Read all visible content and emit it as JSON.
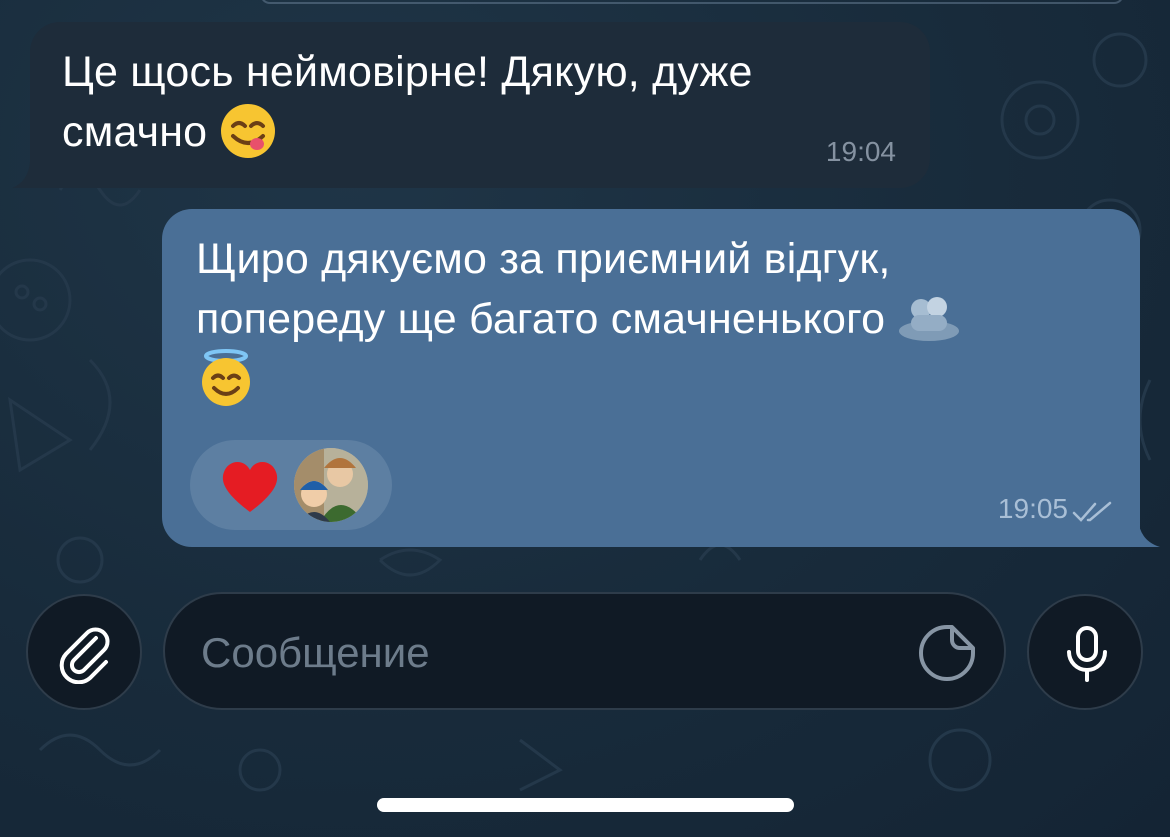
{
  "messages": [
    {
      "direction": "incoming",
      "line1": "Це щось неймовірне! Дякую, дуже",
      "line2": "смачно",
      "emoji": "yum-face",
      "time": "19:04"
    },
    {
      "direction": "outgoing",
      "line1": "Щиро дякуємо за приємний відгук,",
      "line2": "попереду ще багато смачненького",
      "emojis": [
        "hug-sticker",
        "halo-smile-face"
      ],
      "time": "19:05",
      "read": true,
      "reaction": {
        "emoji": "red-heart",
        "reactor": "avatar-photo"
      }
    }
  ],
  "composer": {
    "placeholder": "Сообщение",
    "attach_icon": "paperclip-icon",
    "sticker_icon": "sticker-icon",
    "mic_icon": "microphone-icon"
  },
  "colors": {
    "incoming_bubble": "#1e2c3a",
    "outgoing_bubble": "#4a6f96",
    "background": "#172a3a"
  }
}
